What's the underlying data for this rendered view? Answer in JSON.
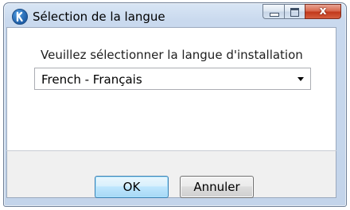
{
  "window": {
    "title": "Sélection de la langue",
    "icon": "setup-k-icon",
    "close_glyph": "x"
  },
  "prompt": "Veuillez sélectionner la langue d'installation",
  "language_select": {
    "selected": "French - Français"
  },
  "buttons": {
    "ok_label": "OK",
    "cancel_label": "Annuler"
  },
  "colors": {
    "ok_border": "#3c7fb1",
    "close_button": "#c2391b"
  }
}
